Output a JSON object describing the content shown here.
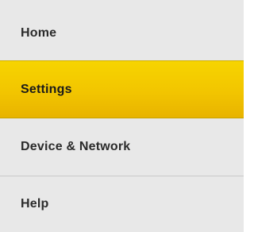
{
  "nav": {
    "active_index": 1,
    "accent_color": "#f2c500",
    "background_color": "#e8e8e8",
    "items": [
      {
        "label": "Home"
      },
      {
        "label": "Settings"
      },
      {
        "label": "Device & Network"
      },
      {
        "label": "Help"
      }
    ]
  }
}
